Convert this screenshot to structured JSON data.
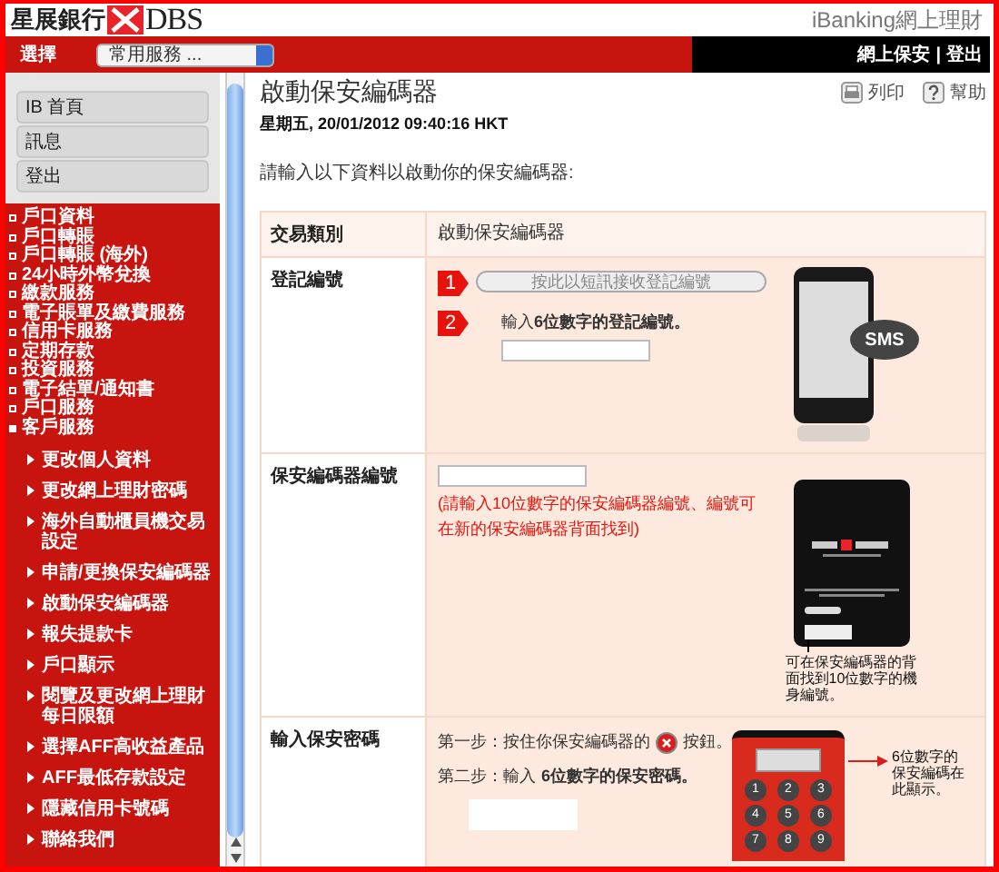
{
  "header": {
    "logo_text": "星展銀行",
    "logo_brand": "DBS",
    "product": "iBanking網上理財"
  },
  "topbar": {
    "select_label": "選擇",
    "dropdown": "常用服務 ...",
    "links": [
      "網上保安",
      "登出"
    ],
    "separator": "|"
  },
  "quick_links": [
    "IB 首頁",
    "訊息",
    "登出"
  ],
  "menu": [
    {
      "label": "戶口資料",
      "expanded": false
    },
    {
      "label": "戶口轉賬",
      "expanded": false
    },
    {
      "label": "戶口轉賬 (海外)",
      "expanded": false
    },
    {
      "label": "24小時外幣兌換",
      "expanded": false
    },
    {
      "label": "繳款服務",
      "expanded": false
    },
    {
      "label": "電子賬單及繳費服務",
      "expanded": false
    },
    {
      "label": "信用卡服務",
      "expanded": false
    },
    {
      "label": "定期存款",
      "expanded": false
    },
    {
      "label": "投資服務",
      "expanded": false
    },
    {
      "label": "電子結單/通知書",
      "expanded": false
    },
    {
      "label": "戶口服務",
      "expanded": false
    },
    {
      "label": "客戶服務",
      "expanded": true,
      "children": [
        {
          "label": "更改個人資料"
        },
        {
          "label": "更改網上理財密碼"
        },
        {
          "label": "海外自動櫃員機交易設定"
        },
        {
          "label": "申請/更換保安編碼器"
        },
        {
          "label": "啟動保安編碼器"
        },
        {
          "label": "報失提款卡"
        },
        {
          "label": "戶口顯示"
        },
        {
          "label": "閱覽及更改網上理財每日限額"
        },
        {
          "label": "選擇AFF高收益產品"
        },
        {
          "label": "AFF最低存款設定"
        },
        {
          "label": "隱藏信用卡號碼"
        },
        {
          "label": "聯絡我們"
        }
      ]
    }
  ],
  "page": {
    "title": "啟動保安編碼器",
    "datetime": "星期五, 20/01/2012 09:40:16 HKT",
    "tools": [
      {
        "kind": "print",
        "label": "列印"
      },
      {
        "kind": "help",
        "label": "幫助"
      }
    ],
    "intro": "請輸入以下資料以啟動你的保安編碼器:"
  },
  "form": {
    "header": {
      "label": "交易類別",
      "value": "啟動保安編碼器"
    },
    "rows": [
      {
        "kind": "registration",
        "label": "登記編號",
        "step1": "1",
        "button": "按此以短訊接收登記編號",
        "button_disabled": true,
        "step2": "2",
        "prompt": "輸入**6位數字的登記編號。**",
        "bubble": "SMS"
      },
      {
        "kind": "serial",
        "label": "保安編碼器編號",
        "note": "(請輸入10位數字的保安編碼器編號、編號可在新的保安編碼器背面找到)",
        "caption": "可在保安編碼器的背面找到10位數字的機身編號。"
      },
      {
        "kind": "password",
        "label": "輸入保安密碼",
        "step1": "第一步：按住你保安編碼器的",
        "step1_end": "按鈕。",
        "step2": "第二步：輸入**6位數字的保安密碼。**",
        "caption": "6位數字的保安編碼在此顯示。",
        "keys": [
          "1",
          "2",
          "3",
          "4",
          "5",
          "6",
          "7",
          "8",
          "9"
        ]
      }
    ]
  }
}
